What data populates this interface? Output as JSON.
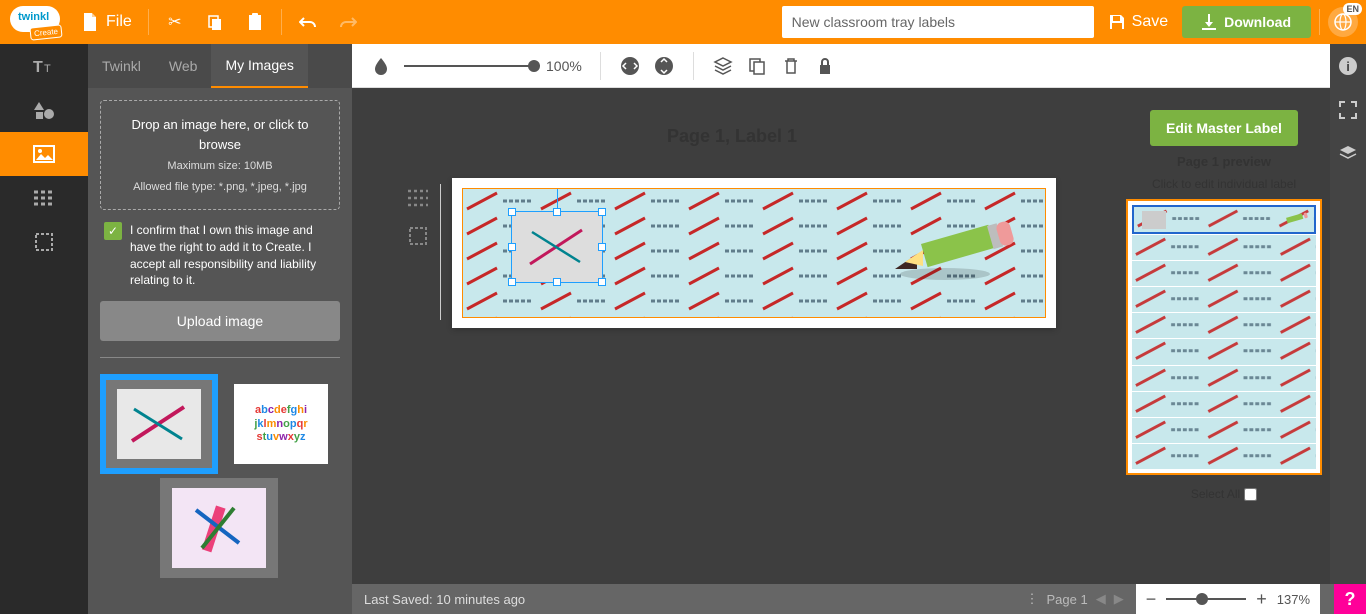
{
  "header": {
    "logo_main": "twinkl",
    "logo_sub": "Create",
    "file_label": "File",
    "doc_name": "New classroom tray labels",
    "save_label": "Save",
    "download_label": "Download",
    "language": "EN"
  },
  "side_panel": {
    "tabs": {
      "twinkl": "Twinkl",
      "web": "Web",
      "my_images": "My Images"
    },
    "dropzone_main": "Drop an image here, or click to browse",
    "dropzone_size": "Maximum size: 10MB",
    "dropzone_types": "Allowed file type: *.png, *.jpeg, *.jpg",
    "confirm_text": "I confirm that I own this image and have the right to add it to Create. I accept all responsibility and liability relating to it.",
    "upload_label": "Upload image"
  },
  "canvas": {
    "opacity_value": "100%",
    "page_title": "Page 1, Label 1"
  },
  "preview": {
    "edit_master": "Edit Master Label",
    "title": "Page 1 preview",
    "subtitle": "Click to edit individual label",
    "select_all": "Select All"
  },
  "status": {
    "last_saved": "Last Saved: 10 minutes ago",
    "page_label": "Page 1",
    "zoom": "137%"
  }
}
